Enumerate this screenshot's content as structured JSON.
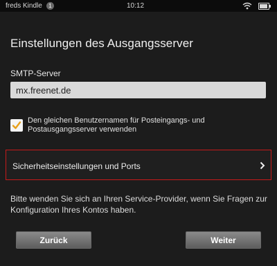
{
  "status_bar": {
    "device_name": "freds Kindle",
    "notification_count": "1",
    "time": "10:12",
    "battery_level": 0.9
  },
  "page": {
    "title": "Einstellungen des Ausgangsserver"
  },
  "smtp": {
    "label": "SMTP-Server",
    "value": "mx.freenet.de"
  },
  "same_username": {
    "checked": true,
    "label": "Den gleichen Benutzernamen für Posteingangs- und Postausgangsserver verwenden"
  },
  "security_row": {
    "label": "Sicherheitseinstellungen und Ports"
  },
  "help": {
    "text": "Bitte wenden Sie sich an Ihren Service-Provider, wenn Sie Fragen zur Konfiguration Ihres Kontos haben."
  },
  "buttons": {
    "back_label": "Zurück",
    "next_label": "Weiter"
  },
  "colors": {
    "background": "#1c1c1c",
    "highlight_border": "#c71a1a",
    "checkbox_accent": "#e8a019"
  }
}
